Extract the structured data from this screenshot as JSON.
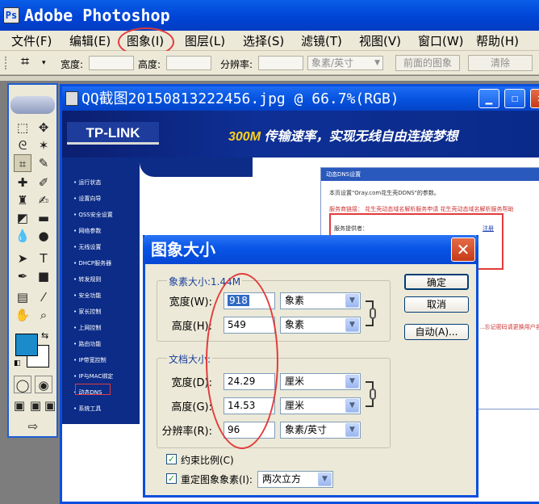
{
  "app": {
    "title": "Adobe Photoshop"
  },
  "menubar": {
    "items": [
      "文件(F)",
      "编辑(E)",
      "图象(I)",
      "图层(L)",
      "选择(S)",
      "滤镜(T)",
      "视图(V)",
      "窗口(W)",
      "帮助(H)"
    ]
  },
  "options": {
    "width_label": "宽度:",
    "height_label": "高度:",
    "resolution_label": "分辨率:",
    "unit_select": "象素/英寸",
    "front_image_button": "前面的图象",
    "clear_button": "清除"
  },
  "document": {
    "title": "QQ截图20150813222456.jpg @ 66.7%(RGB)",
    "header_logo": "TP-LINK",
    "slogan_speed": "300M",
    "slogan_text": "传输速率，实现无线自由连接梦想",
    "sidebar_links": [
      "• 运行状态",
      "• 设置向导",
      "• QSS安全设置",
      "• 网络参数",
      "• 无线设置",
      "• DHCP服务器",
      "• 转发规则",
      "• 安全功能",
      "• 家长控制",
      "• 上网控制",
      "• 路由功能",
      "• IP带宽控制",
      "• IP与MAC绑定",
      "• 动态DNS",
      "• 系统工具"
    ],
    "panel_title": "动态DNS设置",
    "panel_text_1": "本页设置\"Oray.com花生壳DDNS\"的参数。",
    "panel_text_2": "服务商链接：   花生壳动态域名解析服务申请      花生壳动态域名解析服务帮助",
    "panel_text_3": "服务提供者：",
    "panel_link": "注册",
    "panel_text_4": "...忘记密码请更换用户名"
  },
  "dialog": {
    "title": "图象大小",
    "close": "✕",
    "pixel_group_title": "象素大小:1.44M",
    "pixel_width_label": "宽度(W):",
    "pixel_width_value": "918",
    "pixel_width_unit": "象素",
    "pixel_height_label": "高度(H):",
    "pixel_height_value": "549",
    "pixel_height_unit": "象素",
    "doc_group_title": "文档大小:",
    "doc_width_label": "宽度(D):",
    "doc_width_value": "24.29",
    "doc_width_unit": "厘米",
    "doc_height_label": "高度(G):",
    "doc_height_value": "14.53",
    "doc_height_unit": "厘米",
    "resolution_label": "分辨率(R):",
    "resolution_value": "96",
    "resolution_unit": "象素/英寸",
    "ok": "确定",
    "cancel": "取消",
    "auto": "自动(A)...",
    "constrain_label": "约束比例(C)",
    "resample_label": "重定图象象素(I):",
    "resample_method": "两次立方"
  },
  "colors": {
    "titlebar": "#0044d6",
    "annotation": "#e23b3b",
    "foreground_swatch": "#1b8bcc"
  }
}
